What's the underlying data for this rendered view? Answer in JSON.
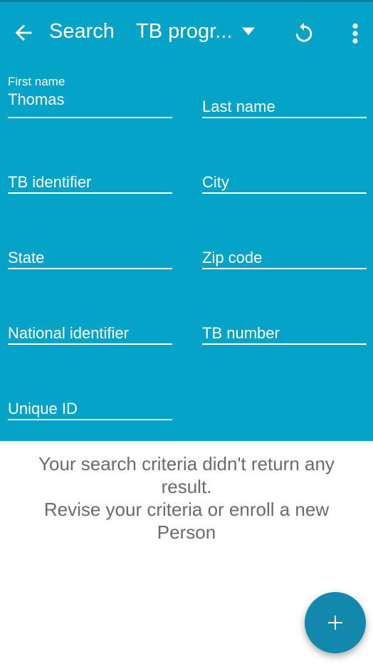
{
  "colors": {
    "primary": "#06a3c9",
    "primary_dark": "#0d7fa3",
    "fab": "#1388ad",
    "text_muted": "#6b6b6b"
  },
  "toolbar": {
    "back_icon": "arrow-back-icon",
    "title": "Search",
    "program_label": "TB progr...",
    "dropdown_icon": "caret-down-icon",
    "refresh_icon": "refresh-icon",
    "more_icon": "more-vert-icon"
  },
  "form": {
    "first_name": {
      "label": "First name",
      "value": "Thomas"
    },
    "last_name": {
      "placeholder": "Last name"
    },
    "tb_identifier": {
      "placeholder": "TB identifier"
    },
    "city": {
      "placeholder": "City"
    },
    "state": {
      "placeholder": "State"
    },
    "zip_code": {
      "placeholder": "Zip code"
    },
    "national_identifier": {
      "placeholder": "National identifier"
    },
    "tb_number": {
      "placeholder": "TB number"
    },
    "unique_id": {
      "placeholder": "Unique ID"
    }
  },
  "empty_state": {
    "line1": "Your search criteria didn't return any result.",
    "line2": "Revise your criteria or enroll a new Person"
  },
  "fab": {
    "icon": "plus-icon"
  }
}
